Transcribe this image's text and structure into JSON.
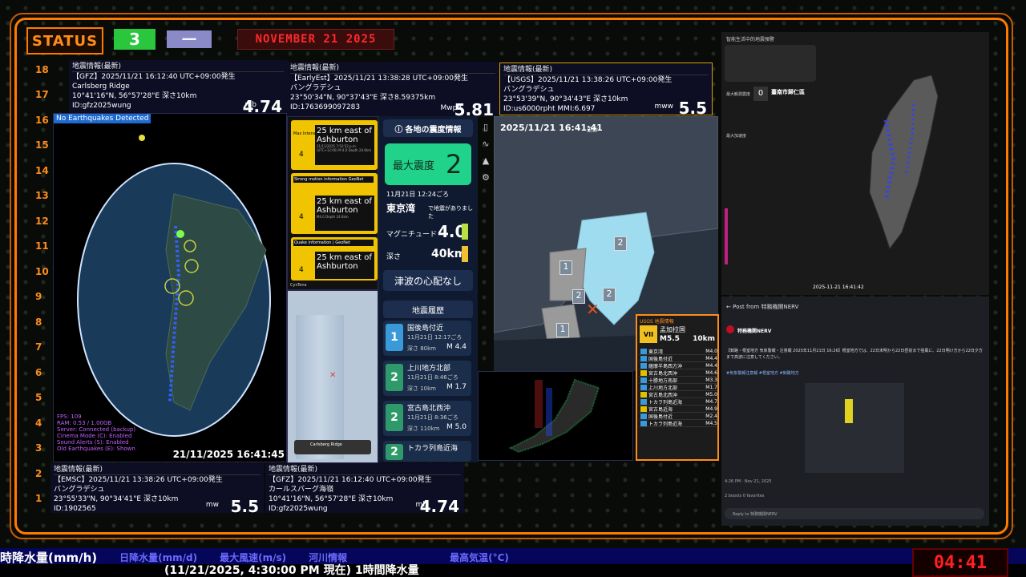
{
  "status": {
    "label": "STATUS",
    "level": "3",
    "sub": "一",
    "date": "NOVEMBER 21 2025"
  },
  "ruler": [
    "18",
    "17",
    "16",
    "15",
    "14",
    "13",
    "12",
    "11",
    "10",
    "9",
    "8",
    "7",
    "6",
    "5",
    "4",
    "3",
    "2",
    "1"
  ],
  "gfz_top": {
    "header": "地震情報(最新)",
    "line1": "【GFZ】2025/11/21 16:12:40 UTC+09:00発生",
    "line2": "Carlsberg Ridge",
    "line3": "10°41'16\"N, 56°57'28\"E 深さ10km",
    "line4": "ID:gfz2025wung",
    "mtype": "mb",
    "mag": "4.74"
  },
  "earlyest": {
    "header": "地震情報(最新)",
    "line1": "【EarlyEst】2025/11/21 13:38:28 UTC+09:00発生",
    "line2": "バングラデシュ",
    "line3": "23°50'34\"N, 90°37'43\"E 深さ8.59375km",
    "line4": "ID:1763699097283",
    "mtype": "Mwpd",
    "mag": "5.81"
  },
  "usgs": {
    "header": "地震情報(最新)",
    "line1": "【USGS】2025/11/21 13:38:26 UTC+09:00発生",
    "line2": "バングラデシュ",
    "line3": "23°53'39\"N, 90°34'43\"E 深さ10km",
    "line4": "ID:us6000rpht MMI:6.697",
    "mtype": "mww",
    "mag": "5.5"
  },
  "globe": {
    "banner": "No Earthquakes Detected",
    "timestamp": "21/11/2025 16:41:45",
    "stats": [
      "FPS: 109",
      "RAM: 0.53 / 1.00GB",
      "Server: Connected (backup)",
      "Cinema Mode (C): Enabled",
      "Sound Alerts (S): Enabled",
      "Old Earthquakes (E): Shown"
    ]
  },
  "emsc": {
    "header": "地震情報(最新)",
    "line1": "【EMSC】2025/11/21 13:38:26 UTC+09:00発生",
    "line2": "バングラデシュ",
    "line3": "23°55'33\"N, 90°34'41\"E 深さ10km",
    "line4": "ID:1902565",
    "mtype": "mw",
    "mag": "5.5"
  },
  "gfz_bot": {
    "header": "地震情報(最新)",
    "line1": "【GFZ】2025/11/21 16:12:40 UTC+09:00発生",
    "line2": "カールスバーグ海嶺",
    "line3": "10°41'16\"N, 56°57'28\"E 深さ10km",
    "line4": "ID:gfz2025wung",
    "mtype": "mb",
    "mag": "4.74"
  },
  "nz": {
    "cards": [
      {
        "title": "Max Intensity",
        "int": "4",
        "place": "25 km east of Ashburton",
        "meta": "21/11/2025 7:52:52 p.m. (UTC+12:00)  M 4.0  Depth 24.6km"
      },
      {
        "title": "Strong motion information GeoNet",
        "int": "4",
        "place": "25 km east of Ashburton",
        "meta": "M4.0  Depth 24.6km"
      },
      {
        "title": "Quake information | GeoNet",
        "int": "4",
        "place": "25 km east of Ashburton",
        "meta": ""
      }
    ],
    "footer": "CysTena",
    "map_label": "Carlsberg Ridge"
  },
  "jma": {
    "title": "各地の震度情報",
    "maxlabel": "最大震度",
    "max": "2",
    "time": "11月21日 12:24ごろ",
    "place": "東京湾",
    "placesuf": "で地震がありました",
    "maglabel": "マグニチュード",
    "mag": "4.0",
    "depthlabel": "深さ",
    "depth": "40km",
    "tsunami": "津波の心配なし",
    "history_title": "地震履歴"
  },
  "history": [
    {
      "int": "1",
      "place": "国後島付近",
      "time": "11月21日 12:17ごろ",
      "depth": "深さ 80km",
      "mag": "M 4.4",
      "color": "#3a9ad9"
    },
    {
      "int": "2",
      "place": "上川地方北部",
      "time": "11月21日 8:46ごろ",
      "depth": "深さ 10km",
      "mag": "M 1.7",
      "color": "#2e9a6a"
    },
    {
      "int": "2",
      "place": "宮古島北西沖",
      "time": "11月21日 8:36ごろ",
      "depth": "深さ 110km",
      "mag": "M 5.0",
      "color": "#2e9a6a"
    },
    {
      "int": "2",
      "place": "トカラ列島近海",
      "time": "",
      "depth": "",
      "mag": "",
      "color": "#2e9a6a"
    }
  ],
  "kanto": {
    "time": "2025/11/21 16:41:41",
    "suffix": "更新",
    "nums": [
      "2",
      "1",
      "2",
      "2",
      "1"
    ]
  },
  "usgs_info": {
    "title": "USGS 地震情報",
    "int": "VII",
    "place": "孟加拉国",
    "mag": "M5.5",
    "depth": "10km",
    "list": [
      {
        "p": "東京湾",
        "m": "M4.0",
        "c": "#3a9ad9"
      },
      {
        "p": "国後島付近",
        "m": "M4.4",
        "c": "#3a9ad9"
      },
      {
        "p": "薩摩半島西方沖",
        "m": "M4.4",
        "c": "#3a9ad9"
      },
      {
        "p": "宮古島北西沖",
        "m": "M4.6",
        "c": "#e0c000"
      },
      {
        "p": "十勝地方南部",
        "m": "M3.3",
        "c": "#3a9ad9"
      },
      {
        "p": "上川地方北部",
        "m": "M1.7",
        "c": "#3a9ad9"
      },
      {
        "p": "宮古島北西沖",
        "m": "M5.0",
        "c": "#e0c000"
      },
      {
        "p": "トカラ列島近海",
        "m": "M4.7",
        "c": "#3a9ad9"
      },
      {
        "p": "宮古島近海",
        "m": "M4.9",
        "c": "#e0c000"
      },
      {
        "p": "国後島付近",
        "m": "M2.4",
        "c": "#3a9ad9"
      },
      {
        "p": "トカラ列島近海",
        "m": "M4.5",
        "c": "#3a9ad9"
      }
    ]
  },
  "taiwan": {
    "title": "智能生活中的地震預警",
    "intlabel": "最大観測震度",
    "int": "0",
    "city": "臺南市歸仁區",
    "pga": "最大加速度",
    "timestamp": "2025-11-21 16:41:42"
  },
  "nerv": {
    "back": "Post from 特務機関NERV",
    "name": "特務機関NERV",
    "body": "【釧路・根室地方 気象警報・注意報 2025年11月21日 16:26】根室地方では、22日未明から22日昼前まで強風に、22日明け方から22日夕方まで高波に注意してください。",
    "tags": "#気象警報注意報 #根室地方 #釧路地方",
    "time": "4:26 PM · Nov 21, 2025",
    "boosts": "2 boosts  0 favorites",
    "reply": "Reply to 特務機関NERV"
  },
  "ticker": {
    "items": [
      "時降水量(mm/h)",
      "日降水量(mm/d)",
      "最大風速(m/s)",
      "河川情報",
      "最高気温(°C)"
    ],
    "sub": "(11/21/2025, 4:30:00 PM 現在) 1時間降水量",
    "clock": "04:41"
  }
}
